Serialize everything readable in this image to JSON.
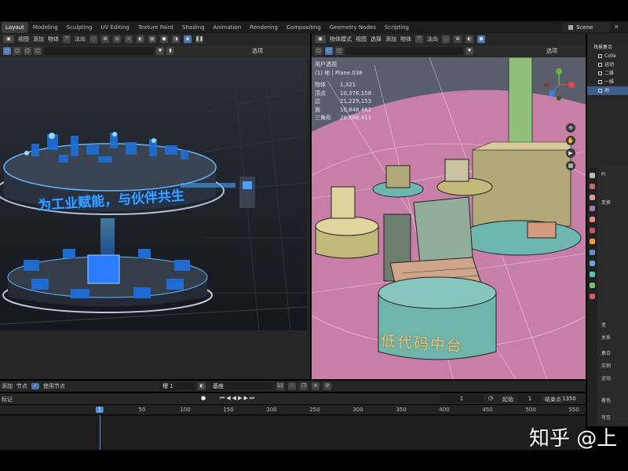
{
  "workspace_tabs": [
    "Layout",
    "Modeling",
    "Sculpting",
    "UV Editing",
    "Texture Paint",
    "Shading",
    "Animation",
    "Rendering",
    "Compositing",
    "Geometry Nodes",
    "Scripting"
  ],
  "active_tab": "Layout",
  "scene_name": "Scene",
  "left_header": {
    "menu_view": "视图",
    "menu_add": "添加",
    "menu_object": "物体",
    "orientation": "法向"
  },
  "left_header2": {
    "options": "选项"
  },
  "right_header": {
    "mode": "物体模式",
    "menu_view": "视图",
    "menu_select": "选择",
    "menu_add": "添加",
    "menu_object": "物体",
    "orientation": "法向"
  },
  "right_header2": {
    "options": "选项"
  },
  "render_caption": "为工业赋能，与伙伴共生",
  "viewport_text": "低代码中台",
  "viewport_info": {
    "view": "用户透视",
    "selection": "(1) 地 | Plane.038",
    "stats": [
      {
        "label": "物体",
        "value": "1,321"
      },
      {
        "label": "顶点",
        "value": "10,376,158"
      },
      {
        "label": "边",
        "value": "21,229,153"
      },
      {
        "label": "面",
        "value": "10,848,462"
      },
      {
        "label": "三角形",
        "value": "20,586,411"
      }
    ]
  },
  "outliner": {
    "title": "场景集合",
    "items": [
      "Colle",
      "运动",
      "二维",
      "一维",
      "地"
    ]
  },
  "properties": {
    "tab": "Pl",
    "section": "变换",
    "rows": [
      "变",
      "关系",
      "集合",
      "实例",
      "运动",
      "着色",
      "可见"
    ]
  },
  "timeline": {
    "menu_add": "添加",
    "menu_node": "节点",
    "use_nodes": "使用节点",
    "slot": "槽 1",
    "material": "基座",
    "users": "11",
    "marker": "标记",
    "current_frame": "1",
    "start_label": "起始",
    "start": "1",
    "end_label": "结束点",
    "end": "1350",
    "ticks": [
      "1",
      "50",
      "100",
      "150",
      "200",
      "250",
      "300",
      "350",
      "400",
      "450",
      "500",
      "550"
    ]
  },
  "watermark": "知乎 @上"
}
